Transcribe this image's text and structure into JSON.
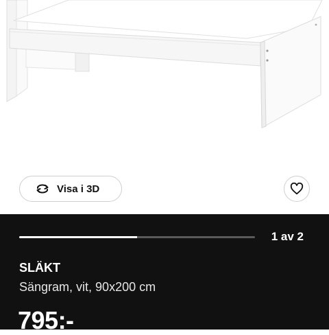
{
  "view_3d": {
    "label": "Visa i 3D",
    "icon": "rotate-3d-icon"
  },
  "favorite": {
    "icon": "heart-icon"
  },
  "gallery": {
    "pager": "1 av 2",
    "progress": 0.5
  },
  "product": {
    "name": "SLÄKT",
    "description": "Sängram, vit, 90x200 cm",
    "price": "795:-"
  },
  "colors": {
    "info_background": "#111111",
    "progress_fill": "#ffffff",
    "progress_track": "#5a5a5a"
  }
}
